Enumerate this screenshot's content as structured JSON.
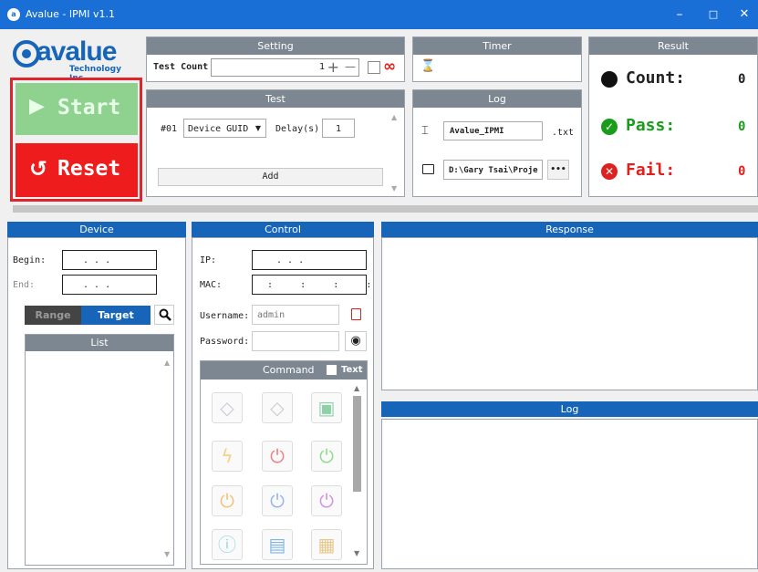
{
  "window": {
    "title": "Avalue - IPMI v1.1",
    "minimize": "–",
    "maximize": "□",
    "close": "✕"
  },
  "logo": {
    "text": "avalue",
    "sub": "Technology Inc."
  },
  "setting": {
    "header": "Setting",
    "test_count_label": "Test Count",
    "test_count_value": "1",
    "plus": "+",
    "minus": "—",
    "infinity": "∞"
  },
  "timer": {
    "header": "Timer",
    "icon": "⌛"
  },
  "result": {
    "header": "Result",
    "count_label": "Count:",
    "count_value": "0",
    "pass_label": "Pass:",
    "pass_value": "0",
    "fail_label": "Fail:",
    "fail_value": "0"
  },
  "actions": {
    "start_label": "Start",
    "reset_label": "Reset"
  },
  "test": {
    "header": "Test",
    "row_no": "#01",
    "device_select": "Device GUID",
    "delay_label": "Delay(s)",
    "delay_value": "1",
    "add_label": "Add"
  },
  "log_top": {
    "header": "Log",
    "filename": "Avalue_IPMI",
    "ext": ".txt",
    "folder": "D:\\Gary Tsai\\Proje",
    "browse": "•••"
  },
  "device": {
    "header": "Device",
    "begin_label": "Begin:",
    "end_label": "End:",
    "ip_placeholder": ".        .        .",
    "range_label": "Range",
    "target_label": "Target",
    "list_header": "List"
  },
  "control": {
    "header": "Control",
    "ip_label": "IP:",
    "ip_value": ".        .        .",
    "mac_label": "MAC:",
    "mac_value": ":     :     :     :     :",
    "username_label": "Username:",
    "username_value": "admin",
    "password_label": "Password:",
    "password_value": "",
    "command_header": "Command",
    "text_toggle": "Text"
  },
  "response": {
    "header": "Response"
  },
  "log_bottom": {
    "header": "Log"
  },
  "colors": {
    "brand_blue": "#1665b9",
    "start_green": "#8fd18f",
    "reset_red": "#ee1c1c",
    "pass_green": "#1a9d1a",
    "fail_red": "#e0201c",
    "highlight_border": "#e0242b"
  },
  "command_icons": [
    "tag-icon",
    "tag-icon",
    "monitor-icon",
    "lightning-icon",
    "power-red-icon",
    "power-green-icon",
    "power-orange-icon",
    "power-blue-icon",
    "power-purple-icon",
    "info-icon",
    "terminal-icon",
    "binary-file-icon"
  ]
}
